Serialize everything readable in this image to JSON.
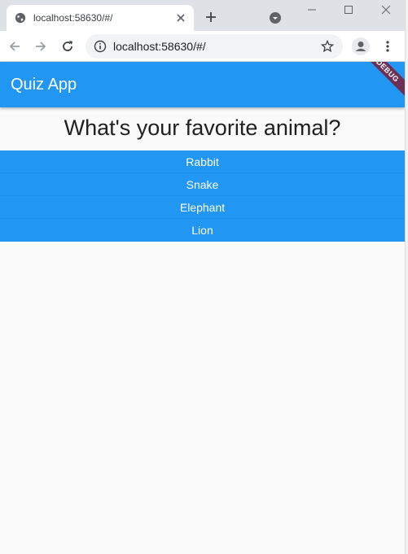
{
  "browser": {
    "tab": {
      "title": "localhost:58630/#/",
      "favicon": "globe-icon",
      "close": "close-icon"
    },
    "new_tab": "plus-icon",
    "tab_search": "tab-search-icon",
    "window_controls": [
      "minimize-icon",
      "maximize-icon",
      "close-icon"
    ],
    "toolbar": {
      "back": "back-arrow-icon",
      "forward": "forward-arrow-icon",
      "reload": "reload-icon",
      "url": "localhost:58630/#/",
      "site_info": "info-icon",
      "bookmark": "star-icon",
      "profile": "profile-icon",
      "menu": "kebab-menu-icon"
    }
  },
  "app": {
    "title": "Quiz App",
    "debug_banner": "DEBUG",
    "question": "What's your favorite animal?",
    "answers": [
      {
        "label": "Rabbit"
      },
      {
        "label": "Snake"
      },
      {
        "label": "Elephant"
      },
      {
        "label": "Lion"
      }
    ],
    "accent_color": "#2196f3",
    "banner_color": "#7a1e38"
  }
}
